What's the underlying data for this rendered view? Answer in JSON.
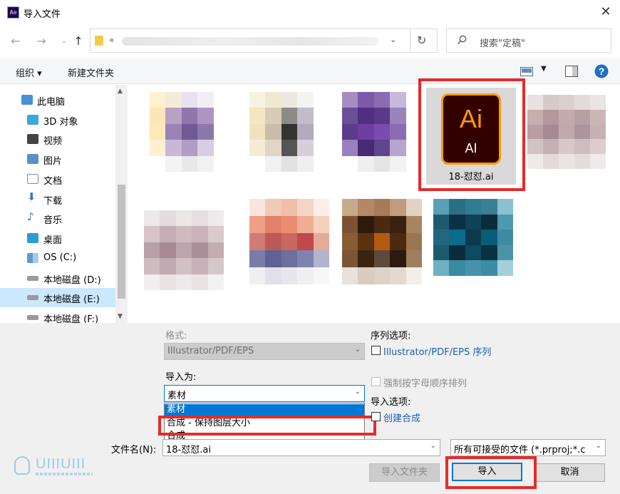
{
  "window": {
    "title": "导入文件",
    "app_icon": "Ae"
  },
  "address": {
    "chevron": "«"
  },
  "search": {
    "placeholder": "搜索\"定稿\""
  },
  "toolbar": {
    "organize": "组织 ▾",
    "new_folder": "新建文件夹"
  },
  "sidebar": {
    "items": [
      {
        "label": "此电脑",
        "icon": "pc-icon",
        "color": "#4a8fd6"
      },
      {
        "label": "3D 对象",
        "icon": "cube-icon",
        "color": "#3aa9d8"
      },
      {
        "label": "视频",
        "icon": "film-icon",
        "color": "#444444"
      },
      {
        "label": "图片",
        "icon": "picture-icon",
        "color": "#5b8fc7"
      },
      {
        "label": "文档",
        "icon": "document-icon",
        "color": "#7a8ea8"
      },
      {
        "label": "下载",
        "icon": "download-icon",
        "color": "#2f7ad1"
      },
      {
        "label": "音乐",
        "icon": "music-icon",
        "color": "#2f7ad1"
      },
      {
        "label": "桌面",
        "icon": "desktop-icon",
        "color": "#2f9ad8"
      },
      {
        "label": "OS (C:)",
        "icon": "os-drive-icon",
        "color": "#5c9bd6"
      },
      {
        "label": "本地磁盘 (D:)",
        "icon": "drive-icon",
        "color": "#8a8a8a"
      },
      {
        "label": "本地磁盘 (E:)",
        "icon": "drive-icon",
        "color": "#8a8a8a",
        "selected": true
      },
      {
        "label": "本地磁盘 (F:)",
        "icon": "drive-icon",
        "color": "#8a8a8a"
      }
    ]
  },
  "files": {
    "selected": {
      "name": "18-怼怼.ai",
      "big": "Ai",
      "small": "AI"
    }
  },
  "options": {
    "format_label": "格式:",
    "format_value": "Illustrator/PDF/EPS",
    "import_as_label": "导入为:",
    "import_as_value": "素材",
    "import_as_options": [
      "素材",
      "合成 - 保持图层大小",
      "合成"
    ],
    "sequence_label": "序列选项:",
    "sequence_checkbox": "Illustrator/PDF/EPS 序列",
    "alpha_checkbox": "强制按字母顺序排列",
    "import_options_label": "导入选项:",
    "create_comp_checkbox": "创建合成"
  },
  "filename": {
    "label": "文件名(N):",
    "value": "18-怼怼.ai"
  },
  "filetype": {
    "value": "所有可接受的文件 (*.prproj;*.c"
  },
  "buttons": {
    "import_folder": "导入文件夹",
    "import": "导入",
    "cancel": "取消"
  },
  "watermark": {
    "text": "UIIIUIII"
  },
  "colors": {
    "accent": "#0078d7",
    "highlight_red": "#e52b2b",
    "ai_orange": "#ff9a00",
    "ai_bg": "#330000"
  }
}
